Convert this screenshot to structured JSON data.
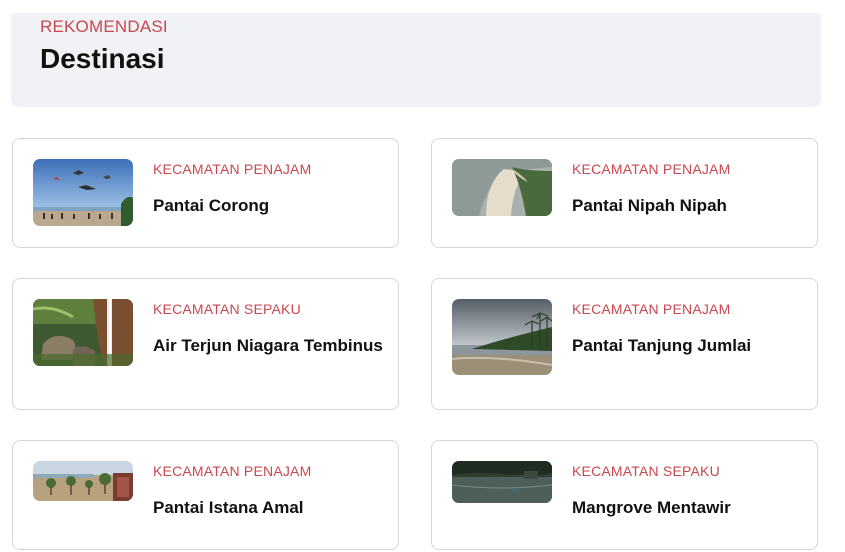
{
  "section": {
    "eyebrow": "REKOMENDASI",
    "title": "Destinasi"
  },
  "colors": {
    "accent": "#c9484f",
    "panel_bg": "#f0f2f5",
    "card_border": "#d4d6da"
  },
  "destinations": [
    {
      "district": "KECAMATAN PENAJAM",
      "name": "Pantai Corong",
      "thumbnail": "beach-kites-photo"
    },
    {
      "district": "KECAMATAN PENAJAM",
      "name": "Pantai Nipah Nipah",
      "thumbnail": "coastline-aerial-photo"
    },
    {
      "district": "KECAMATAN SEPAKU",
      "name": "Air Terjun Niagara Tembinus",
      "thumbnail": "waterfall-photo"
    },
    {
      "district": "KECAMATAN PENAJAM",
      "name": "Pantai Tanjung Jumlai",
      "thumbnail": "palm-beach-photo"
    },
    {
      "district": "KECAMATAN PENAJAM",
      "name": "Pantai Istana Amal",
      "thumbnail": "beach-park-photo"
    },
    {
      "district": "KECAMATAN SEPAKU",
      "name": "Mangrove Mentawir",
      "thumbnail": "mangrove-river-photo"
    }
  ]
}
